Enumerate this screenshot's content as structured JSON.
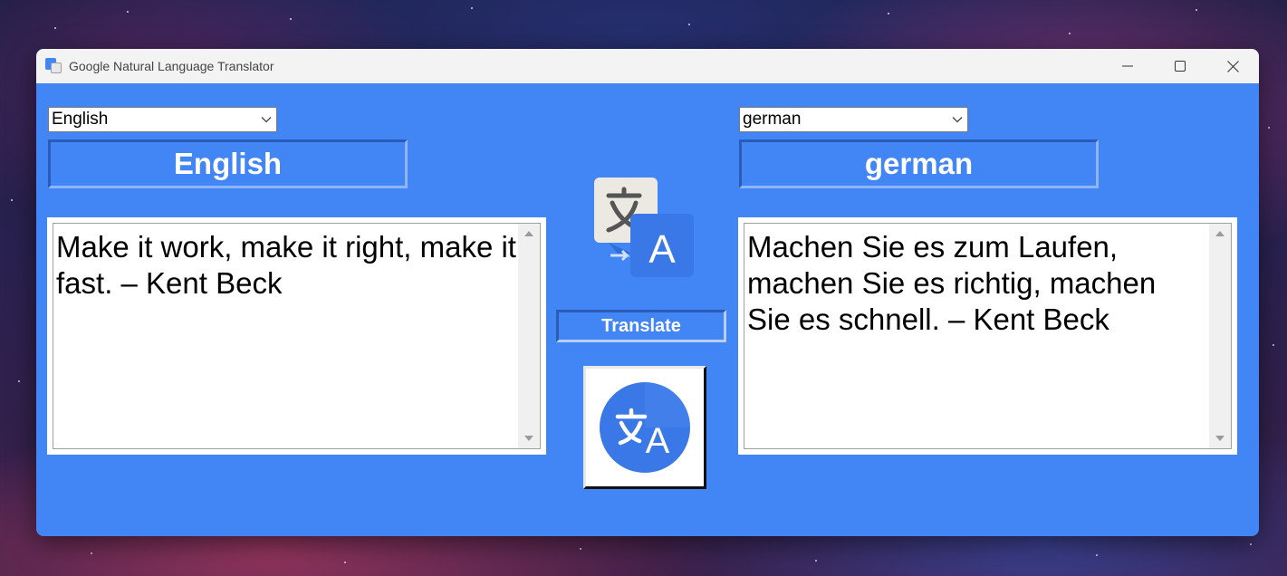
{
  "window": {
    "title": "Google Natural Language Translator"
  },
  "source": {
    "selected_language": "English",
    "label": "English",
    "text": "Make it work, make it right, make it\nfast. – Kent Beck"
  },
  "target": {
    "selected_language": "german",
    "label": "german",
    "text": "Machen Sie es zum Laufen,\nmachen Sie es richtig, machen\nSie es schnell. – Kent Beck"
  },
  "actions": {
    "translate_label": "Translate"
  },
  "colors": {
    "accent": "#4285f4",
    "titlebar": "#f3f3f3"
  },
  "icons": {
    "app": "google-translate-icon",
    "minimize": "minimize-icon",
    "maximize": "maximize-icon",
    "close": "close-icon",
    "dropdown": "chevron-down-icon",
    "logo": "google-translate-logo-icon",
    "round_logo": "translate-circle-icon"
  }
}
